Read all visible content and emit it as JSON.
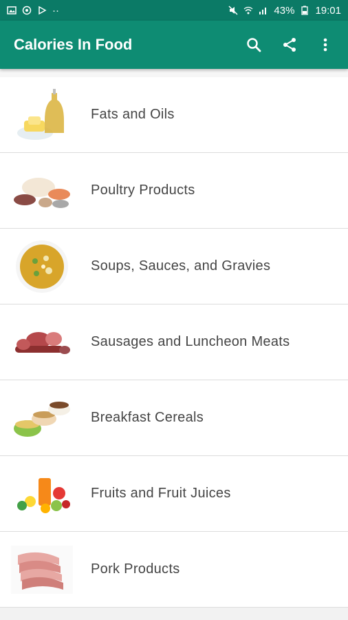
{
  "status_bar": {
    "battery": "43%",
    "time": "19:01",
    "left_icons": [
      "image-icon",
      "circle-icon",
      "play-store-icon",
      "more-dots-icon"
    ],
    "right_icons": [
      "mute-icon",
      "wifi-icon",
      "signal-icon",
      "battery-icon"
    ]
  },
  "app_bar": {
    "title": "Calories In Food",
    "actions": [
      "search-icon",
      "share-icon",
      "overflow-menu-icon"
    ],
    "color": "#0e8c73"
  },
  "categories": [
    {
      "label": "Fats and Oils",
      "icon": "oil-butter-image"
    },
    {
      "label": "Poultry Products",
      "icon": "poultry-image"
    },
    {
      "label": "Soups, Sauces, and Gravies",
      "icon": "soup-image"
    },
    {
      "label": "Sausages and Luncheon Meats",
      "icon": "sausage-image"
    },
    {
      "label": "Breakfast Cereals",
      "icon": "cereal-image"
    },
    {
      "label": "Fruits and Fruit Juices",
      "icon": "fruit-juice-image"
    },
    {
      "label": "Pork Products",
      "icon": "pork-image"
    }
  ]
}
